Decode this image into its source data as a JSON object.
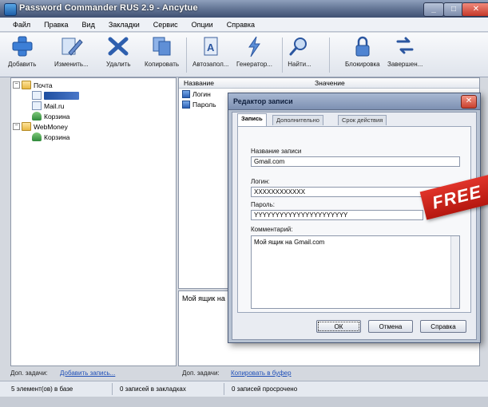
{
  "window": {
    "title": "Password Commander RUS 2.9 - Ancytue",
    "minimize_glyph": "_",
    "maximize_glyph": "□",
    "close_glyph": "✕"
  },
  "menu": [
    "Файл",
    "Правка",
    "Вид",
    "Закладки",
    "Сервис",
    "Опции",
    "Справка"
  ],
  "toolbar": [
    {
      "label": "Добавить",
      "icon": "add-record-icon"
    },
    {
      "label": "Изменить...",
      "icon": "edit-icon"
    },
    {
      "label": "Удалить",
      "icon": "delete-icon"
    },
    {
      "label": "Копировать",
      "icon": "copy-icon"
    },
    {
      "label": "Автозапол...",
      "icon": "autofill-icon"
    },
    {
      "label": "Генератор...",
      "icon": "generator-icon"
    },
    {
      "label": "Найти...",
      "icon": "search-icon"
    },
    {
      "label": "Блокировка",
      "icon": "lock-icon"
    },
    {
      "label": "Завершен...",
      "icon": "exit-icon"
    }
  ],
  "tree": {
    "root1": "Почта",
    "root1_items": [
      "Mail.ru",
      "Корзина"
    ],
    "root2": "WebMoney",
    "root2_items": [
      "Корзина"
    ]
  },
  "list": {
    "col_name": "Название",
    "col_value": "Значение",
    "rows": [
      "Логин",
      "Пароль"
    ]
  },
  "preview": {
    "text": "Мой ящик на"
  },
  "dialog": {
    "title": "Редактор записи",
    "close_glyph": "✕",
    "tabs": [
      "Запись",
      "Дополнительно",
      "Срок действия"
    ],
    "record_name_label": "Название записи",
    "record_name_value": "Gmail.com",
    "login_label": "Логин:",
    "login_value": "XXXXXXXXXXXX",
    "password_label": "Пароль:",
    "password_value": "YYYYYYYYYYYYYYYYYYYYYY",
    "comment_label": "Комментарий:",
    "comment_value": "Мой ящик на Gmail.com",
    "ok_label": "ОК",
    "cancel_label": "Отмена",
    "help_label": "Справка"
  },
  "ribbon": {
    "text": "FREE"
  },
  "tasks": {
    "label1": "Доп. задачи:",
    "link1": "Добавить запись...",
    "label2": "Доп. задачи:",
    "link2": "Копировать в буфер"
  },
  "status": {
    "cell1": "5 элемент(ов) в базе",
    "cell2": "0 записей в закладках",
    "cell3": "0 записей просрочено"
  },
  "colors": {
    "titlebar": "#5f7191",
    "accent": "#1f4fb8",
    "ribbon": "#d12a20"
  }
}
